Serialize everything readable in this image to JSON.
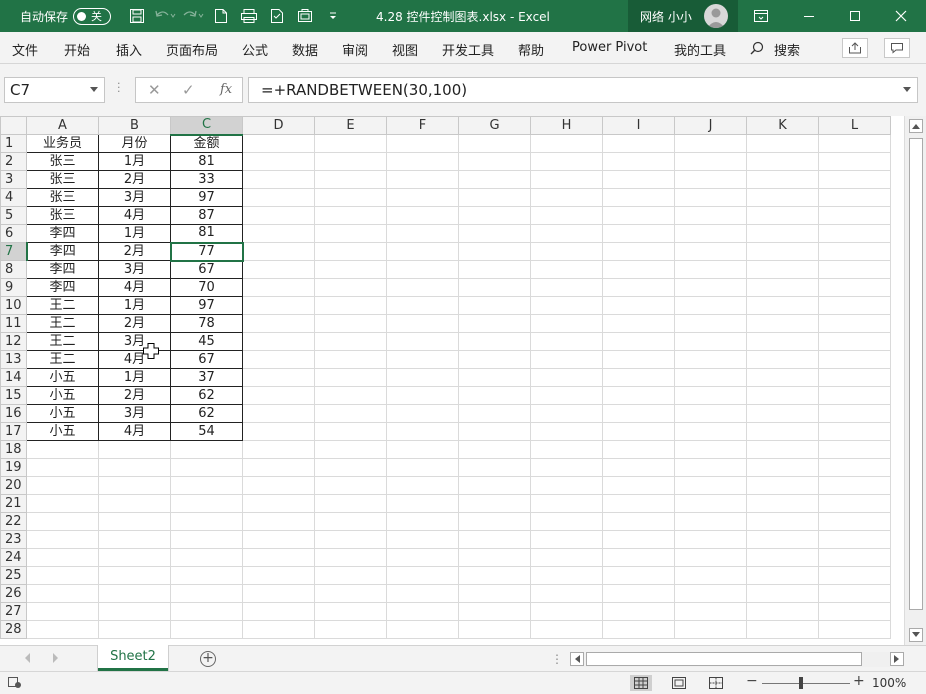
{
  "titlebar": {
    "autosave_label": "自动保存",
    "autosave_state": "关",
    "document_title": "4.28 控件控制图表.xlsx  -  Excel",
    "user_name": "网络 小小",
    "icons": [
      "save-icon",
      "undo-icon",
      "redo-icon",
      "new-file-icon",
      "print-preview-icon",
      "form-icon",
      "camera-icon",
      "customize-qat-icon",
      "ribbon-display-icon",
      "minimize-icon",
      "maximize-icon",
      "close-icon"
    ],
    "accent_color": "#217346"
  },
  "ribbon": {
    "tabs": [
      "文件",
      "开始",
      "插入",
      "页面布局",
      "公式",
      "数据",
      "审阅",
      "视图",
      "开发工具",
      "帮助",
      "Power Pivot",
      "我的工具"
    ],
    "search_label": "搜索"
  },
  "formula_bar": {
    "name_box": "C7",
    "fx_label": "fx",
    "formula": "=+RANDBETWEEN(30,100)"
  },
  "grid": {
    "columns": [
      "A",
      "B",
      "C",
      "D",
      "E",
      "F",
      "G",
      "H",
      "I",
      "J",
      "K",
      "L"
    ],
    "row_numbers": [
      "1",
      "2",
      "3",
      "4",
      "5",
      "6",
      "7",
      "8",
      "9",
      "10",
      "11",
      "12",
      "13",
      "14",
      "15",
      "16",
      "17",
      "18",
      "19",
      "20",
      "21",
      "22",
      "23",
      "24",
      "25",
      "26",
      "27",
      "28"
    ],
    "active_cell": "C7",
    "table_headers": [
      "业务员",
      "月份",
      "金额"
    ],
    "table_rows": [
      [
        "张三",
        "1月",
        "81"
      ],
      [
        "张三",
        "2月",
        "33"
      ],
      [
        "张三",
        "3月",
        "97"
      ],
      [
        "张三",
        "4月",
        "87"
      ],
      [
        "李四",
        "1月",
        "81"
      ],
      [
        "李四",
        "2月",
        "77"
      ],
      [
        "李四",
        "3月",
        "67"
      ],
      [
        "李四",
        "4月",
        "70"
      ],
      [
        "王二",
        "1月",
        "97"
      ],
      [
        "王二",
        "2月",
        "78"
      ],
      [
        "王二",
        "3月",
        "45"
      ],
      [
        "王二",
        "4月",
        "67"
      ],
      [
        "小五",
        "1月",
        "37"
      ],
      [
        "小五",
        "2月",
        "62"
      ],
      [
        "小五",
        "3月",
        "62"
      ],
      [
        "小五",
        "4月",
        "54"
      ]
    ]
  },
  "sheets": {
    "tabs": [
      "Sheet2"
    ],
    "active": "Sheet2"
  },
  "statusbar": {
    "zoom_level": "100%"
  }
}
